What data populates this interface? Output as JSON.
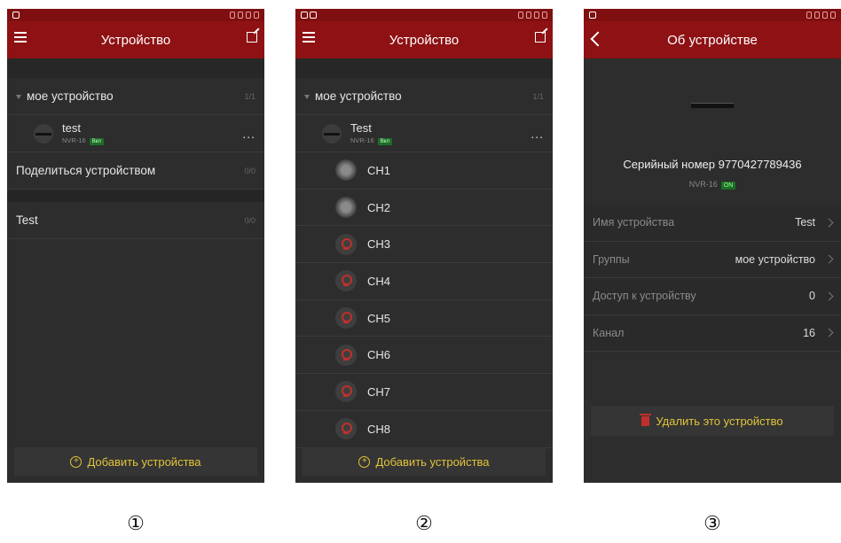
{
  "screen1": {
    "title": "Устройство",
    "group": {
      "label": "мое устройство",
      "count": "1/1"
    },
    "device": {
      "name": "test",
      "model": "NVR-16",
      "status": "Вкл",
      "more": "..."
    },
    "share": {
      "label": "Поделиться устройством",
      "count": "0/0"
    },
    "test_group": {
      "label": "Test",
      "count": "0/0"
    },
    "add_label": "Добавить устройства"
  },
  "screen2": {
    "title": "Устройство",
    "group": {
      "label": "мое устройство",
      "count": "1/1"
    },
    "device": {
      "name": "Test",
      "model": "NVR-16",
      "status": "Вкл",
      "more": "..."
    },
    "channels": [
      {
        "label": "CH1",
        "icon": "thumbnail"
      },
      {
        "label": "CH2",
        "icon": "thumbnail"
      },
      {
        "label": "CH3",
        "icon": "camera"
      },
      {
        "label": "CH4",
        "icon": "camera"
      },
      {
        "label": "CH5",
        "icon": "camera"
      },
      {
        "label": "CH6",
        "icon": "camera"
      },
      {
        "label": "CH7",
        "icon": "camera"
      },
      {
        "label": "CH8",
        "icon": "camera"
      }
    ],
    "add_label": "Добавить устройства"
  },
  "screen3": {
    "title": "Об устройстве",
    "serial": "Серийный номер 9770427789436",
    "model": "NVR-16",
    "status": "ON",
    "rows": [
      {
        "key": "Имя устройства",
        "value": "Test"
      },
      {
        "key": "Группы",
        "value": "мое устройство"
      },
      {
        "key": "Доступ к устройству",
        "value": "0"
      },
      {
        "key": "Канал",
        "value": "16"
      }
    ],
    "delete_label": "Удалить это устройство"
  },
  "markers": [
    "①",
    "②",
    "③"
  ],
  "colors": {
    "header": "#8e1114",
    "accent": "#e2c43a",
    "background": "#2d2d2d",
    "online": "#1d6e25"
  }
}
